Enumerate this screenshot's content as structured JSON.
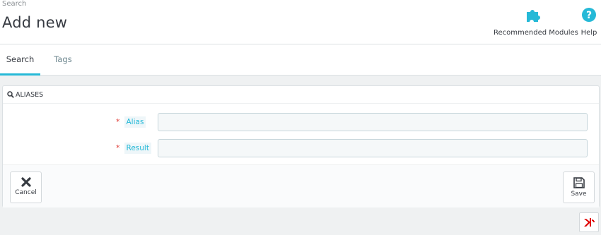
{
  "header": {
    "breadcrumb": "Search",
    "title": "Add new",
    "toolbar": {
      "modules_label": "Recommended Modules",
      "modules_icon": "puzzle-icon",
      "help_label": "Help",
      "help_icon": "help-circle-icon"
    }
  },
  "tabs": [
    {
      "label": "Search",
      "active": true
    },
    {
      "label": "Tags",
      "active": false
    }
  ],
  "panel": {
    "heading": "ALIASES",
    "heading_icon": "search-icon",
    "fields": [
      {
        "label": "Alias",
        "required": "*",
        "value": ""
      },
      {
        "label": "Result",
        "required": "*",
        "value": ""
      }
    ],
    "footer": {
      "cancel_label": "Cancel",
      "cancel_icon": "close-icon",
      "save_label": "Save",
      "save_icon": "floppy-disk-icon"
    }
  },
  "colors": {
    "accent": "#25b9d7",
    "required": "#e0403a",
    "background": "#eff1f2"
  }
}
